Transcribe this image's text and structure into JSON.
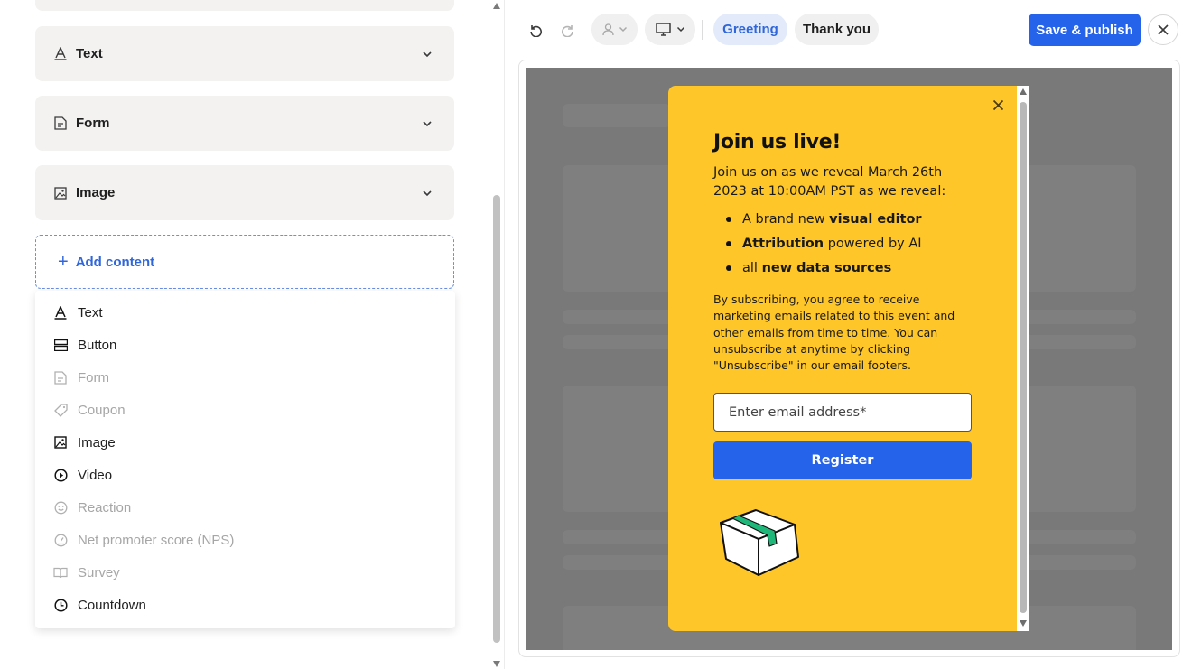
{
  "left_panel": {
    "sections": [
      {
        "label": "Text",
        "icon": "text-format-icon"
      },
      {
        "label": "Form",
        "icon": "form-icon"
      },
      {
        "label": "Image",
        "icon": "image-icon"
      }
    ],
    "add_content_label": "Add content",
    "menu_items": [
      {
        "label": "Text",
        "icon": "text-format-icon",
        "enabled": true
      },
      {
        "label": "Button",
        "icon": "button-icon",
        "enabled": true
      },
      {
        "label": "Form",
        "icon": "form-icon",
        "enabled": false
      },
      {
        "label": "Coupon",
        "icon": "coupon-icon",
        "enabled": false
      },
      {
        "label": "Image",
        "icon": "image-icon",
        "enabled": true
      },
      {
        "label": "Video",
        "icon": "video-icon",
        "enabled": true
      },
      {
        "label": "Reaction",
        "icon": "smiley-icon",
        "enabled": false
      },
      {
        "label": "Net promoter score (NPS)",
        "icon": "gauge-icon",
        "enabled": false
      },
      {
        "label": "Survey",
        "icon": "book-icon",
        "enabled": false
      },
      {
        "label": "Countdown",
        "icon": "clock-icon",
        "enabled": true
      }
    ]
  },
  "toolbar": {
    "tabs": [
      {
        "label": "Greeting",
        "active": true
      },
      {
        "label": "Thank you",
        "active": false
      }
    ],
    "save_label": "Save & publish"
  },
  "popup": {
    "title": "Join us live!",
    "intro": "Join us on as we reveal March 26th 2023 at 10:00AM PST as we reveal:",
    "bullets": [
      {
        "pre": "A brand new ",
        "bold": "visual editor",
        "post": ""
      },
      {
        "pre": "",
        "bold": "Attribution",
        "post": " powered by AI"
      },
      {
        "pre": "all ",
        "bold": "new data sources",
        "post": ""
      }
    ],
    "legal": "By subscribing, you agree to receive marketing emails related to this event and other emails from time to time. You can unsubscribe at anytime by clicking \"Unsubscribe\" in our email footers.",
    "email_placeholder": "Enter email address*",
    "register_label": "Register"
  },
  "colors": {
    "accent": "#2663eb",
    "popup_bg": "#fec629",
    "canvas_overlay": "#797979",
    "tab_active_bg": "#e3ebfb",
    "tab_active_text": "#2f66d9"
  }
}
